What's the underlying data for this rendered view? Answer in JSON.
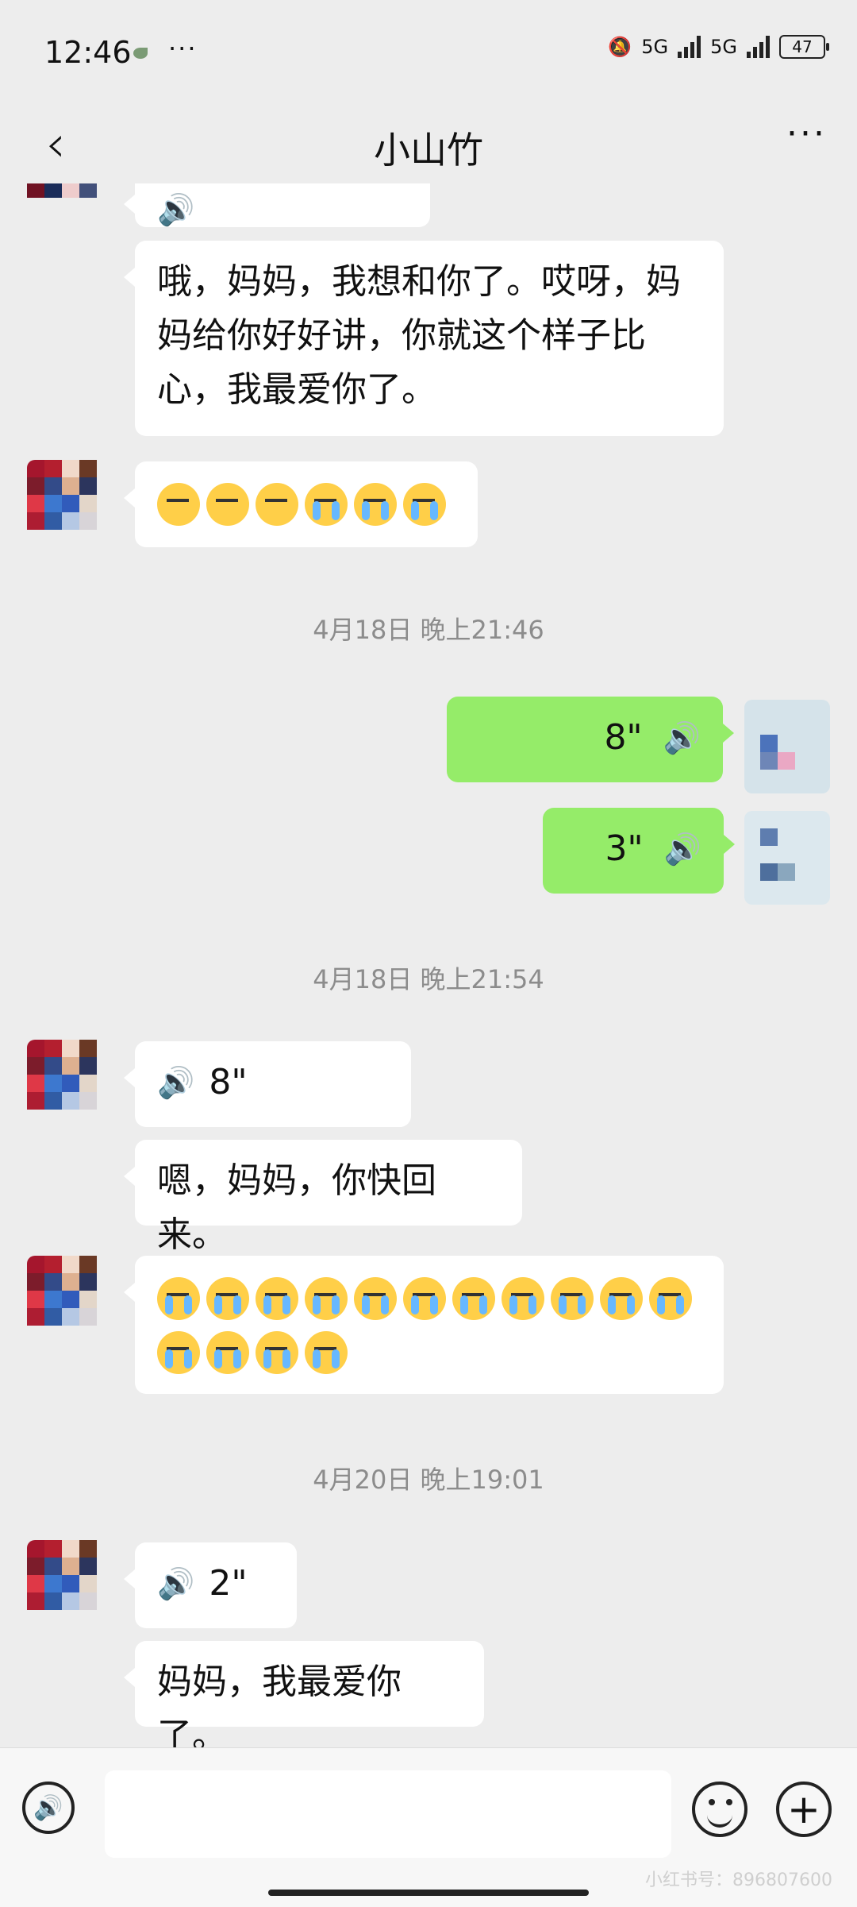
{
  "status_bar": {
    "time": "12:46",
    "dots": "···",
    "net1": "5G",
    "net2": "5G",
    "battery": "47"
  },
  "header": {
    "title": "小山竹",
    "back_icon": "chevron-left-icon",
    "more_icon": "more-icon"
  },
  "messages": [
    {
      "type": "text",
      "side": "left",
      "text": "哦，妈妈，我想和你了。哎呀，妈妈给你好好讲，你就这个样子比心，我最爱你了。"
    },
    {
      "type": "emoji",
      "side": "left",
      "emoji_pattern": [
        "laugh",
        "laugh",
        "laugh",
        "cry",
        "cry",
        "cry"
      ]
    },
    {
      "type": "time",
      "text": "4月18日 晚上21:46"
    },
    {
      "type": "voice",
      "side": "right",
      "duration": "8\""
    },
    {
      "type": "voice",
      "side": "right",
      "duration": "3\""
    },
    {
      "type": "time",
      "text": "4月18日 晚上21:54"
    },
    {
      "type": "voice",
      "side": "left",
      "duration": "8\""
    },
    {
      "type": "text",
      "side": "left",
      "text": "嗯，妈妈，你快回来。"
    },
    {
      "type": "emoji",
      "side": "left",
      "emoji_pattern": [
        "cry",
        "cry",
        "cry",
        "cry",
        "cry",
        "cry",
        "cry",
        "cry",
        "cry",
        "cry",
        "cry",
        "cry",
        "cry",
        "cry",
        "cry"
      ]
    },
    {
      "type": "time",
      "text": "4月20日 晚上19:01"
    },
    {
      "type": "voice",
      "side": "left",
      "duration": "2\""
    },
    {
      "type": "text",
      "side": "left",
      "text": "妈妈，我最爱你了。"
    }
  ],
  "input_bar": {
    "voice_icon": "voice-toggle-icon",
    "emoji_icon": "emoji-icon",
    "plus_icon": "plus-icon",
    "watermark": "小红书号：896807600"
  }
}
